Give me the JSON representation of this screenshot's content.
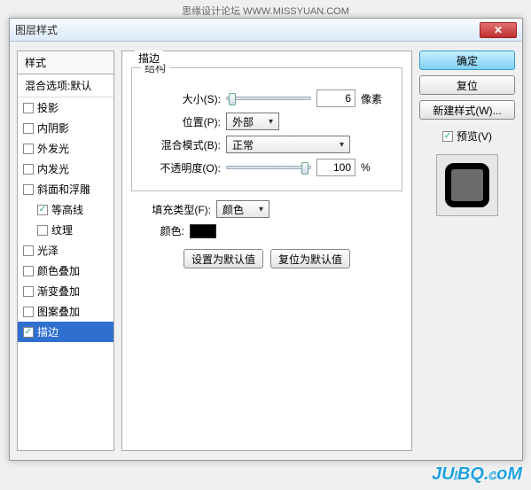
{
  "topbar_text": "思缘设计论坛  WWW.MISSYUAN.COM",
  "dialog_title": "图层样式",
  "styles_header": "样式",
  "blend_options": "混合选项:默认",
  "styles": [
    {
      "label": "投影",
      "checked": false,
      "indent": false
    },
    {
      "label": "内阴影",
      "checked": false,
      "indent": false
    },
    {
      "label": "外发光",
      "checked": false,
      "indent": false
    },
    {
      "label": "内发光",
      "checked": false,
      "indent": false
    },
    {
      "label": "斜面和浮雕",
      "checked": false,
      "indent": false
    },
    {
      "label": "等高线",
      "checked": true,
      "indent": true
    },
    {
      "label": "纹理",
      "checked": false,
      "indent": true
    },
    {
      "label": "光泽",
      "checked": false,
      "indent": false
    },
    {
      "label": "颜色叠加",
      "checked": false,
      "indent": false
    },
    {
      "label": "渐变叠加",
      "checked": false,
      "indent": false
    },
    {
      "label": "图案叠加",
      "checked": false,
      "indent": false
    },
    {
      "label": "描边",
      "checked": true,
      "indent": false,
      "selected": true
    }
  ],
  "panel_title": "描边",
  "structure_legend": "结构",
  "size_label": "大小(S):",
  "size_value": "6",
  "size_unit": "像素",
  "position_label": "位置(P):",
  "position_value": "外部",
  "blendmode_label": "混合模式(B):",
  "blendmode_value": "正常",
  "opacity_label": "不透明度(O):",
  "opacity_value": "100",
  "opacity_unit": "%",
  "filltype_label": "填充类型(F):",
  "filltype_value": "颜色",
  "color_label": "颜色:",
  "color_value": "#000000",
  "default_btn": "设置为默认值",
  "reset_btn": "复位为默认值",
  "ok_btn": "确定",
  "revert_btn": "复位",
  "newstyle_btn": "新建样式(W)...",
  "preview_label": "预览(V)",
  "preview_checked": true,
  "watermark": "JUiBQ.CoM"
}
